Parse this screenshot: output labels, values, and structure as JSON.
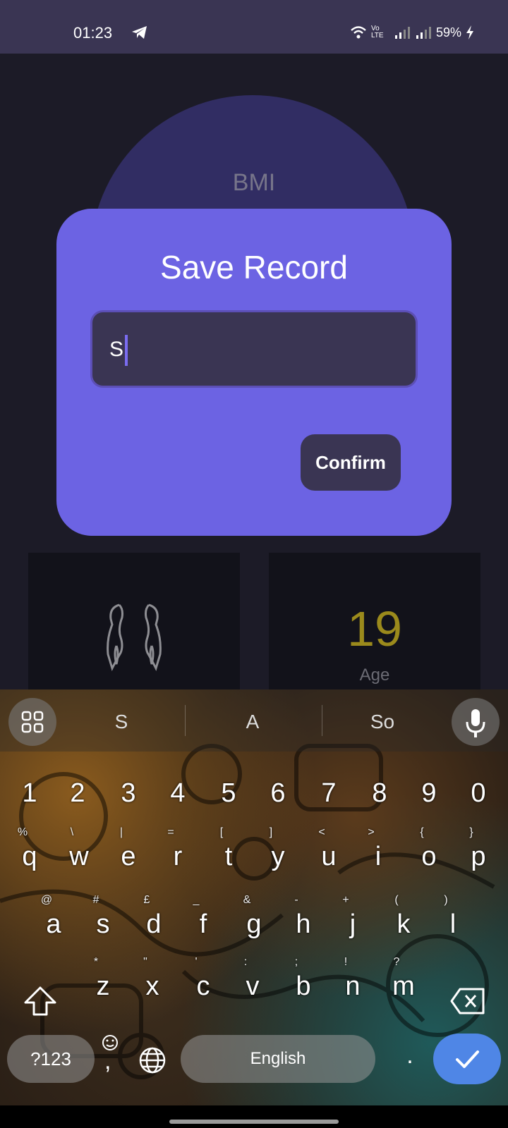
{
  "status_bar": {
    "time": "01:23",
    "battery": "59%",
    "network_label": "Vo LTE"
  },
  "background_app": {
    "gauge_label": "BMI",
    "age_value": "19",
    "age_label": "Age"
  },
  "dialog": {
    "title": "Save Record",
    "input_value": "S",
    "confirm_label": "Confirm",
    "accent": "#6c63e3"
  },
  "keyboard": {
    "suggestions": [
      "S",
      "A",
      "So"
    ],
    "number_row": [
      "1",
      "2",
      "3",
      "4",
      "5",
      "6",
      "7",
      "8",
      "9",
      "0"
    ],
    "row1": [
      {
        "key": "q",
        "hint": "%"
      },
      {
        "key": "w",
        "hint": "\\"
      },
      {
        "key": "e",
        "hint": "|"
      },
      {
        "key": "r",
        "hint": "="
      },
      {
        "key": "t",
        "hint": "["
      },
      {
        "key": "y",
        "hint": "]"
      },
      {
        "key": "u",
        "hint": "<"
      },
      {
        "key": "i",
        "hint": ">"
      },
      {
        "key": "o",
        "hint": "{"
      },
      {
        "key": "p",
        "hint": "}"
      }
    ],
    "row2": [
      {
        "key": "a",
        "hint": "@"
      },
      {
        "key": "s",
        "hint": "#"
      },
      {
        "key": "d",
        "hint": "£"
      },
      {
        "key": "f",
        "hint": "_"
      },
      {
        "key": "g",
        "hint": "&"
      },
      {
        "key": "h",
        "hint": "-"
      },
      {
        "key": "j",
        "hint": "+"
      },
      {
        "key": "k",
        "hint": "("
      },
      {
        "key": "l",
        "hint": ")"
      }
    ],
    "row3": [
      {
        "key": "z",
        "hint": "*"
      },
      {
        "key": "x",
        "hint": "\""
      },
      {
        "key": "c",
        "hint": "'"
      },
      {
        "key": "v",
        "hint": ":"
      },
      {
        "key": "b",
        "hint": ";"
      },
      {
        "key": "n",
        "hint": "!"
      },
      {
        "key": "m",
        "hint": "?"
      }
    ],
    "symbols_label": "?123",
    "comma_label": ",",
    "space_label": "English",
    "period_label": ".",
    "icons": [
      "grid-icon",
      "mic-icon",
      "shift-icon",
      "backspace-icon",
      "emoji-icon",
      "globe-icon",
      "check-icon"
    ]
  }
}
